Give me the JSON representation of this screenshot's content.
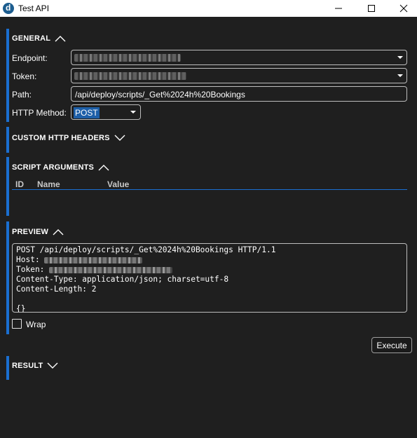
{
  "window": {
    "title": "Test API",
    "icons": {
      "app": "app-logo-icon",
      "minimize": "minimize-icon",
      "maximize": "maximize-icon",
      "close": "close-icon"
    }
  },
  "colors": {
    "accent": "#1a6fd1",
    "background": "#1f1f1f",
    "selection": "#1d5fa8"
  },
  "general": {
    "title": "GENERAL",
    "endpoint_label": "Endpoint:",
    "token_label": "Token:",
    "path_label": "Path:",
    "path_value": "/api/deploy/scripts/_Get%2024h%20Bookings",
    "method_label": "HTTP Method:",
    "method_value": "POST"
  },
  "custom_headers": {
    "title": "CUSTOM HTTP HEADERS"
  },
  "script_arguments": {
    "title": "SCRIPT ARGUMENTS",
    "columns": [
      "ID",
      "Name",
      "Value"
    ]
  },
  "preview": {
    "title": "PREVIEW",
    "request_line": "POST /api/deploy/scripts/_Get%2024h%20Bookings HTTP/1.1",
    "host_label": "Host: ",
    "token_label": "Token: ",
    "content_type": "Content-Type: application/json; charset=utf-8",
    "content_length": "Content-Length: 2",
    "body": "{}",
    "wrap_label": "Wrap"
  },
  "execute_label": "Execute",
  "result": {
    "title": "RESULT"
  }
}
